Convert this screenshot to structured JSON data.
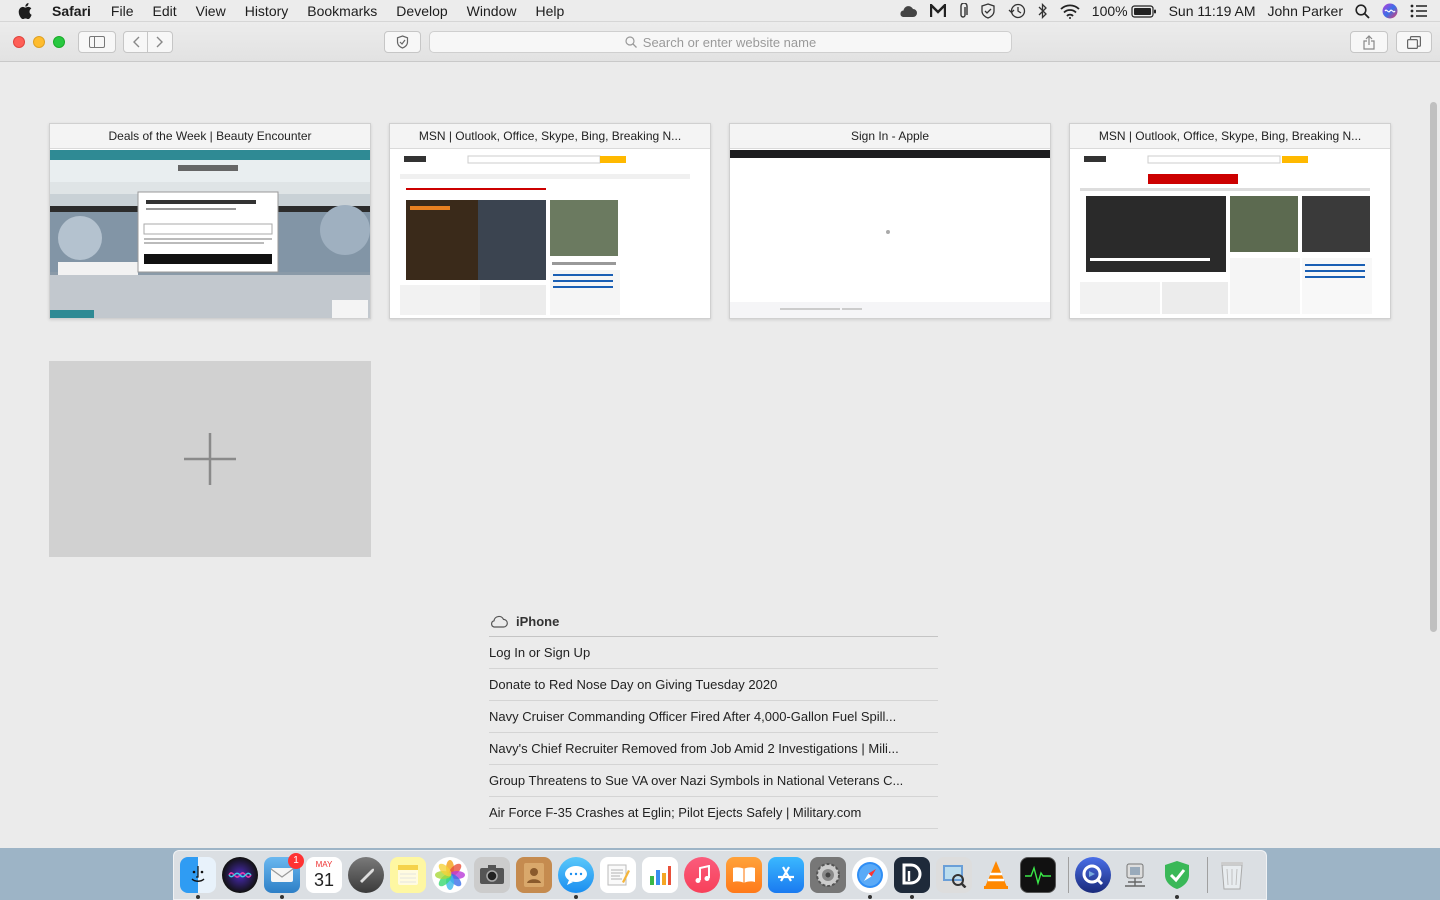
{
  "menubar": {
    "app": "Safari",
    "items": [
      "File",
      "Edit",
      "View",
      "History",
      "Bookmarks",
      "Develop",
      "Window",
      "Help"
    ],
    "battery": "100%",
    "clock": "Sun 11:19 AM",
    "user": "John Parker"
  },
  "toolbar": {
    "address_placeholder": "Search or enter website name"
  },
  "tabs": [
    {
      "title": "Deals of the Week | Beauty Encounter"
    },
    {
      "title": "MSN | Outlook, Office, Skype, Bing, Breaking N..."
    },
    {
      "title": "Sign In - Apple"
    },
    {
      "title": "MSN | Outlook, Office, Skype, Bing, Breaking N..."
    }
  ],
  "icloud": {
    "device": "iPhone",
    "links": [
      "Log In or Sign Up",
      "Donate to Red Nose Day on Giving Tuesday 2020",
      "Navy Cruiser Commanding Officer Fired After 4,000-Gallon Fuel Spill...",
      "Navy's Chief Recruiter Removed from Job Amid 2 Investigations | Mili...",
      "Group Threatens to Sue VA over Nazi Symbols in National Veterans C...",
      "Air Force F-35 Crashes at Eglin; Pilot Ejects Safely | Military.com"
    ]
  },
  "dock": {
    "mail_badge": "1",
    "calendar_month": "MAY",
    "calendar_day": "31"
  },
  "colors": {
    "close": "#fe5f57",
    "minimize": "#febc2e",
    "maximize": "#28c840",
    "dock_badge": "#ff3333"
  }
}
